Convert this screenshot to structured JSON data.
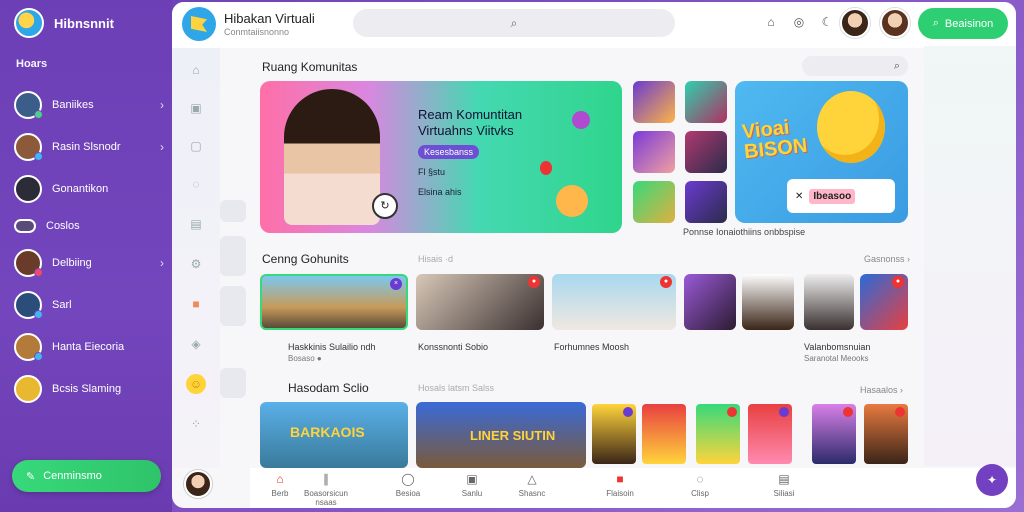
{
  "sidebar": {
    "brand": "Hibnsnnit",
    "section": "Hoars",
    "items": [
      {
        "label": "Baniikes",
        "chev": "›",
        "dot": "#4ad18a",
        "avatar": "#3a5d8a"
      },
      {
        "label": "Rasin Slsnodr",
        "chev": "›",
        "dot": "#3fb7f0",
        "avatar": "#8c5a3a"
      },
      {
        "label": "Gonantikon",
        "chev": "",
        "dot": "",
        "avatar": "#2c2c38"
      },
      {
        "label": "Coslos",
        "chev": "",
        "dot": "",
        "avatar": "#5a4b7a"
      },
      {
        "label": "Delbiing",
        "chev": "›",
        "dot": "#f04a6a",
        "avatar": "#6a3b2a"
      },
      {
        "label": "Sarl",
        "chev": "",
        "dot": "#3fb7f0",
        "avatar": "#2b4d7a"
      },
      {
        "label": "Hanta Eiecoria",
        "chev": "",
        "dot": "#3fb7f0",
        "avatar": "#b47a3a"
      },
      {
        "label": "Bcsis Slaming",
        "chev": "",
        "dot": "",
        "avatar": "#e8b830"
      }
    ],
    "cta": "Cenminsmo"
  },
  "topbar": {
    "title": "Hibakan Virtuali",
    "subtitle": "Conmtaiisnonno",
    "button": "Beaisinon"
  },
  "main": {
    "heading": "Ruang Komunitas",
    "hero": {
      "title": "Ream Komuntitan Virtuahns Viitvks",
      "chip": "Kesesbanss",
      "line1": "Fl §stu",
      "line2": "Elsina ahis"
    },
    "promo": {
      "word1": "Vioai",
      "word2": "BISON",
      "card": "Ibeasoo",
      "caption": "Ponnse Ionaiothiins onbbspise"
    },
    "section2": {
      "title": "Cenng Gohunits",
      "tag": "Hisais ·d",
      "more": "Gasnonss ›"
    },
    "videos": [
      {
        "caption": "Haskkinis Sulailio ndh",
        "sub": "Bosaso ●"
      },
      {
        "caption": "Konssnonti Sobio",
        "sub": ""
      },
      {
        "caption": "Forhumnes Moosh",
        "sub": ""
      },
      {
        "caption": "Valanbomsnuian",
        "sub": "Saranotal Meooks"
      }
    ],
    "section3": {
      "title": "Hasodam Sclio",
      "tag": "Hosals latsm Salss",
      "more": "Hasaalos ›"
    },
    "bigs": [
      {
        "label": "BARKAOIS"
      },
      {
        "label": "LINER SIUTIN"
      }
    ]
  },
  "bottom_nav": [
    {
      "label": "Berb",
      "icon": "home-icon"
    },
    {
      "label": "Boasorsicun nsaas",
      "icon": "bars-icon"
    },
    {
      "label": "Besioa",
      "icon": "chat-icon"
    },
    {
      "label": "Sanlu",
      "icon": "image-icon"
    },
    {
      "label": "Shasnc",
      "icon": "bell-icon"
    },
    {
      "label": "Flaisoin",
      "icon": "card-icon"
    },
    {
      "label": "Clisp",
      "icon": "message-icon"
    },
    {
      "label": "Siliasi",
      "icon": "box-icon"
    }
  ],
  "colors": {
    "sidebar": "#7446bd",
    "accent_green": "#2ecf73"
  }
}
